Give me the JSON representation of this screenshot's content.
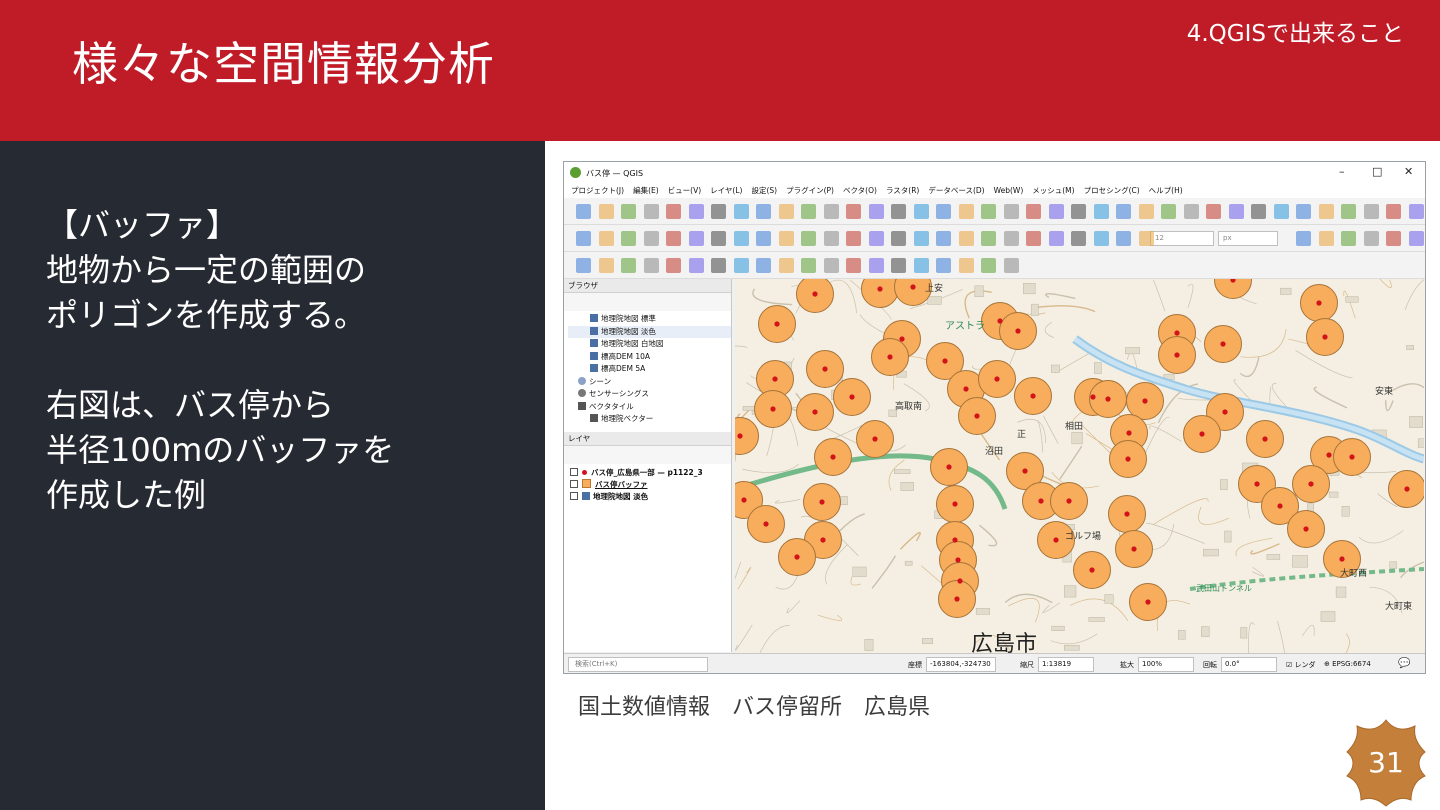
{
  "header": {
    "title": "様々な空間情報分析",
    "section": "4.QGISで出来ること"
  },
  "body": {
    "lines_a": [
      "【バッファ】",
      "地物から一定の範囲の",
      "ポリゴンを作成する。"
    ],
    "lines_b": [
      "右図は、バス停から",
      "半径100mのバッファを",
      "作成した例"
    ]
  },
  "screenshot": {
    "window_title": "バス停 — QGIS",
    "menu": [
      "プロジェクト(J)",
      "編集(E)",
      "ビュー(V)",
      "レイヤ(L)",
      "設定(S)",
      "プラグイン(P)",
      "ベクタ(O)",
      "ラスタ(R)",
      "データベース(D)",
      "Web(W)",
      "メッシュ(M)",
      "プロセシング(C)",
      "ヘルプ(H)"
    ],
    "browser_panel": {
      "title": "ブラウザ",
      "items": [
        "地理院地図 標準",
        "地理院地図 淡色",
        "地理院地図 白地図",
        "標高DEM 10A",
        "標高DEM 5A",
        "シーン",
        "センサーシングス",
        "ベクタタイル",
        "地理院ベクター"
      ]
    },
    "layers_panel": {
      "title": "レイヤ",
      "layers": [
        "バス停_広島県一部 — p1122_3",
        "バス停バッファ",
        "地理院地図 淡色"
      ]
    },
    "statusbar": {
      "search_placeholder": "検索(Ctrl+K)",
      "coord_label": "座標",
      "coord_value": "-163804,-324730",
      "scale_label": "縮尺",
      "scale_value": "1:13819",
      "magnify_label": "拡大",
      "magnify_value": "100%",
      "rotation_label": "回転",
      "rotation_value": "0.0°",
      "render_label": "レンダ",
      "crs": "EPSG:6674"
    },
    "toolbar_fields": {
      "size": "12",
      "unit": "px"
    },
    "map": {
      "bg_color": "#f4efe2",
      "buffer_fill": "#f7ad5b",
      "buffer_stroke": "#a8743a",
      "stop_color": "#d3131b",
      "railway_color": "#74b98a",
      "labels": [
        "アストラ",
        "上安",
        "安東",
        "高取南",
        "相田",
        "正",
        "沼田",
        "大町西",
        "大町東",
        "武田山トンネル",
        "ゴルフ場",
        "広島市"
      ]
    }
  },
  "caption": "国土数値情報　バス停留所　広島県",
  "page_number": "31"
}
